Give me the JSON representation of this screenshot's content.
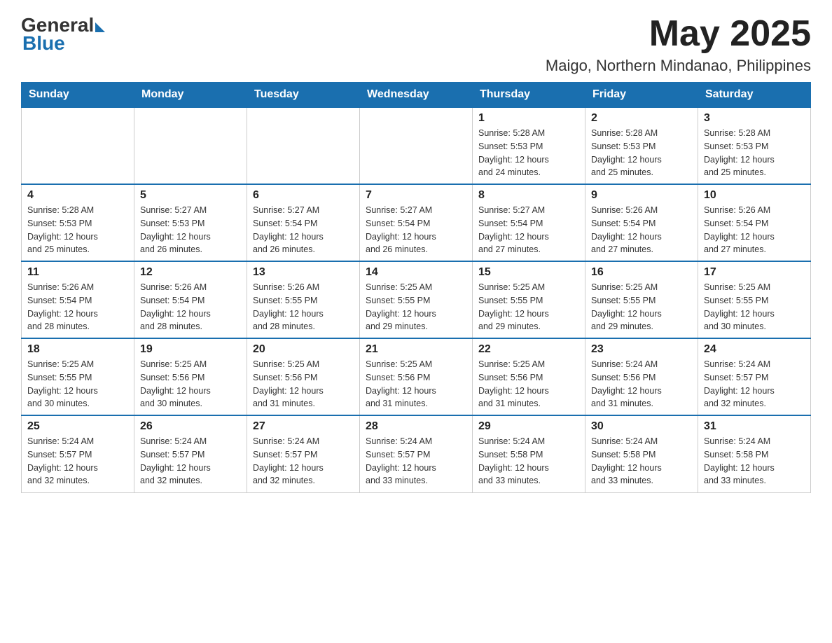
{
  "header": {
    "logo": {
      "general": "General",
      "blue": "Blue"
    },
    "title": "May 2025",
    "location": "Maigo, Northern Mindanao, Philippines"
  },
  "days_of_week": [
    "Sunday",
    "Monday",
    "Tuesday",
    "Wednesday",
    "Thursday",
    "Friday",
    "Saturday"
  ],
  "weeks": [
    {
      "days": [
        {
          "number": "",
          "info": ""
        },
        {
          "number": "",
          "info": ""
        },
        {
          "number": "",
          "info": ""
        },
        {
          "number": "",
          "info": ""
        },
        {
          "number": "1",
          "info": "Sunrise: 5:28 AM\nSunset: 5:53 PM\nDaylight: 12 hours\nand 24 minutes."
        },
        {
          "number": "2",
          "info": "Sunrise: 5:28 AM\nSunset: 5:53 PM\nDaylight: 12 hours\nand 25 minutes."
        },
        {
          "number": "3",
          "info": "Sunrise: 5:28 AM\nSunset: 5:53 PM\nDaylight: 12 hours\nand 25 minutes."
        }
      ]
    },
    {
      "days": [
        {
          "number": "4",
          "info": "Sunrise: 5:28 AM\nSunset: 5:53 PM\nDaylight: 12 hours\nand 25 minutes."
        },
        {
          "number": "5",
          "info": "Sunrise: 5:27 AM\nSunset: 5:53 PM\nDaylight: 12 hours\nand 26 minutes."
        },
        {
          "number": "6",
          "info": "Sunrise: 5:27 AM\nSunset: 5:54 PM\nDaylight: 12 hours\nand 26 minutes."
        },
        {
          "number": "7",
          "info": "Sunrise: 5:27 AM\nSunset: 5:54 PM\nDaylight: 12 hours\nand 26 minutes."
        },
        {
          "number": "8",
          "info": "Sunrise: 5:27 AM\nSunset: 5:54 PM\nDaylight: 12 hours\nand 27 minutes."
        },
        {
          "number": "9",
          "info": "Sunrise: 5:26 AM\nSunset: 5:54 PM\nDaylight: 12 hours\nand 27 minutes."
        },
        {
          "number": "10",
          "info": "Sunrise: 5:26 AM\nSunset: 5:54 PM\nDaylight: 12 hours\nand 27 minutes."
        }
      ]
    },
    {
      "days": [
        {
          "number": "11",
          "info": "Sunrise: 5:26 AM\nSunset: 5:54 PM\nDaylight: 12 hours\nand 28 minutes."
        },
        {
          "number": "12",
          "info": "Sunrise: 5:26 AM\nSunset: 5:54 PM\nDaylight: 12 hours\nand 28 minutes."
        },
        {
          "number": "13",
          "info": "Sunrise: 5:26 AM\nSunset: 5:55 PM\nDaylight: 12 hours\nand 28 minutes."
        },
        {
          "number": "14",
          "info": "Sunrise: 5:25 AM\nSunset: 5:55 PM\nDaylight: 12 hours\nand 29 minutes."
        },
        {
          "number": "15",
          "info": "Sunrise: 5:25 AM\nSunset: 5:55 PM\nDaylight: 12 hours\nand 29 minutes."
        },
        {
          "number": "16",
          "info": "Sunrise: 5:25 AM\nSunset: 5:55 PM\nDaylight: 12 hours\nand 29 minutes."
        },
        {
          "number": "17",
          "info": "Sunrise: 5:25 AM\nSunset: 5:55 PM\nDaylight: 12 hours\nand 30 minutes."
        }
      ]
    },
    {
      "days": [
        {
          "number": "18",
          "info": "Sunrise: 5:25 AM\nSunset: 5:55 PM\nDaylight: 12 hours\nand 30 minutes."
        },
        {
          "number": "19",
          "info": "Sunrise: 5:25 AM\nSunset: 5:56 PM\nDaylight: 12 hours\nand 30 minutes."
        },
        {
          "number": "20",
          "info": "Sunrise: 5:25 AM\nSunset: 5:56 PM\nDaylight: 12 hours\nand 31 minutes."
        },
        {
          "number": "21",
          "info": "Sunrise: 5:25 AM\nSunset: 5:56 PM\nDaylight: 12 hours\nand 31 minutes."
        },
        {
          "number": "22",
          "info": "Sunrise: 5:25 AM\nSunset: 5:56 PM\nDaylight: 12 hours\nand 31 minutes."
        },
        {
          "number": "23",
          "info": "Sunrise: 5:24 AM\nSunset: 5:56 PM\nDaylight: 12 hours\nand 31 minutes."
        },
        {
          "number": "24",
          "info": "Sunrise: 5:24 AM\nSunset: 5:57 PM\nDaylight: 12 hours\nand 32 minutes."
        }
      ]
    },
    {
      "days": [
        {
          "number": "25",
          "info": "Sunrise: 5:24 AM\nSunset: 5:57 PM\nDaylight: 12 hours\nand 32 minutes."
        },
        {
          "number": "26",
          "info": "Sunrise: 5:24 AM\nSunset: 5:57 PM\nDaylight: 12 hours\nand 32 minutes."
        },
        {
          "number": "27",
          "info": "Sunrise: 5:24 AM\nSunset: 5:57 PM\nDaylight: 12 hours\nand 32 minutes."
        },
        {
          "number": "28",
          "info": "Sunrise: 5:24 AM\nSunset: 5:57 PM\nDaylight: 12 hours\nand 33 minutes."
        },
        {
          "number": "29",
          "info": "Sunrise: 5:24 AM\nSunset: 5:58 PM\nDaylight: 12 hours\nand 33 minutes."
        },
        {
          "number": "30",
          "info": "Sunrise: 5:24 AM\nSunset: 5:58 PM\nDaylight: 12 hours\nand 33 minutes."
        },
        {
          "number": "31",
          "info": "Sunrise: 5:24 AM\nSunset: 5:58 PM\nDaylight: 12 hours\nand 33 minutes."
        }
      ]
    }
  ]
}
